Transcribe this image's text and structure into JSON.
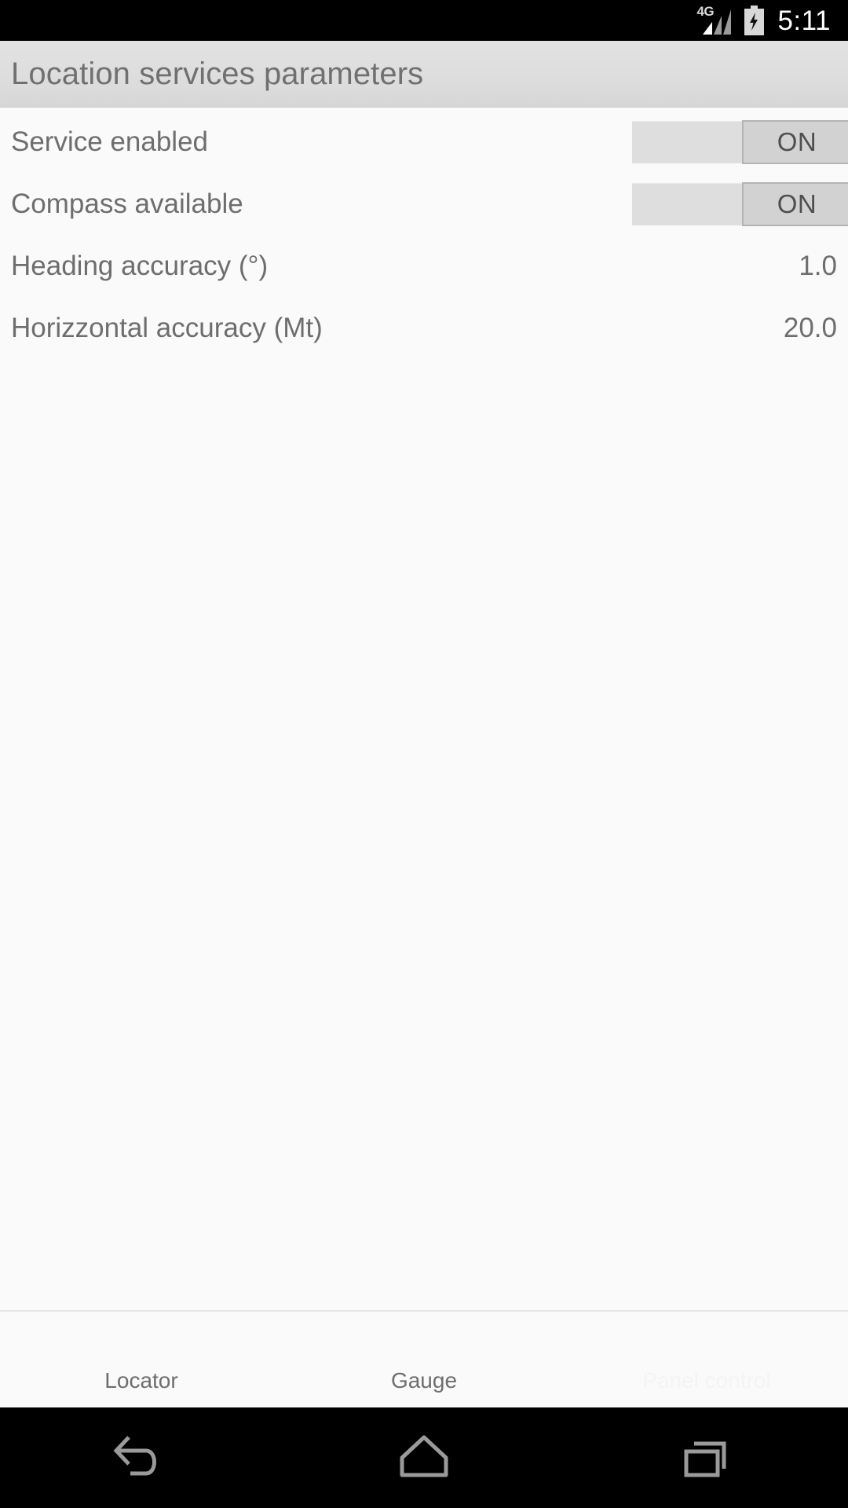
{
  "status_bar": {
    "network_label": "4G",
    "signal_icon": "signal-bars-icon",
    "battery_icon": "battery-charging-icon",
    "time": "5:11"
  },
  "action_bar": {
    "title": "Location services parameters"
  },
  "list": {
    "rows": [
      {
        "label": "Service enabled",
        "type": "toggle",
        "toggle_label": "ON",
        "value": ""
      },
      {
        "label": "Compass available",
        "type": "toggle",
        "toggle_label": "ON",
        "value": ""
      },
      {
        "label": "Heading accuracy (°)",
        "type": "value",
        "toggle_label": "",
        "value": "1.0"
      },
      {
        "label": "Horizzontal accuracy (Mt)",
        "type": "value",
        "toggle_label": "",
        "value": "20.0"
      }
    ]
  },
  "tab_bar": {
    "tabs": [
      {
        "label": "Locator",
        "state": "enabled"
      },
      {
        "label": "Gauge",
        "state": "enabled"
      },
      {
        "label": "Panel control",
        "state": "disabled"
      }
    ]
  },
  "nav_bar": {
    "back_icon": "back-arrow-icon",
    "home_icon": "home-icon",
    "recents_icon": "recent-apps-icon"
  },
  "colors": {
    "status_bar_bg": "#000000",
    "action_bar_bg": "#dcdcdc",
    "content_bg": "#fafafa",
    "text": "#6e6e6e",
    "toggle_track": "#dedede",
    "toggle_thumb": "#d2d2d2",
    "nav_icon": "#9a9a9a"
  }
}
